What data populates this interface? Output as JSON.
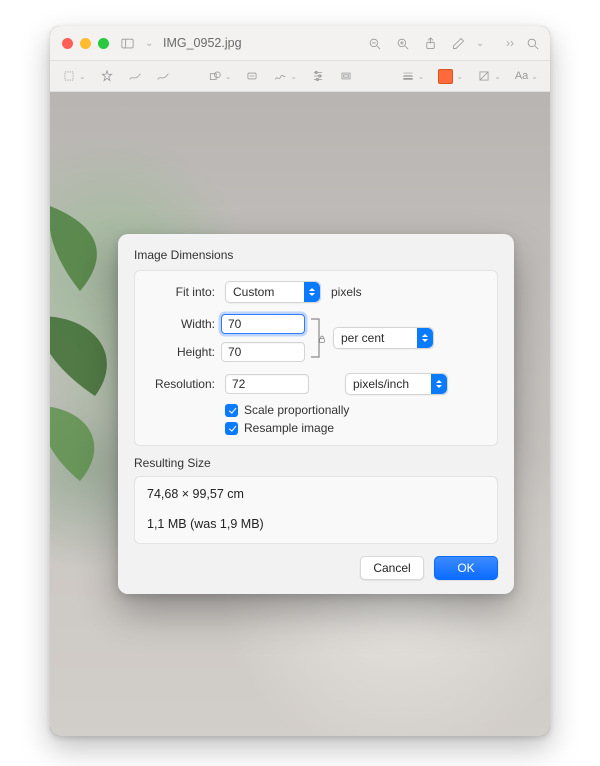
{
  "window": {
    "title": "IMG_0952.jpg"
  },
  "dialog": {
    "section_title": "Image Dimensions",
    "fit_into_label": "Fit into:",
    "fit_into_value": "Custom",
    "fit_into_unit": "pixels",
    "width_label": "Width:",
    "width_value": "70",
    "height_label": "Height:",
    "height_value": "70",
    "wh_unit": "per cent",
    "resolution_label": "Resolution:",
    "resolution_value": "72",
    "resolution_unit": "pixels/inch",
    "scale_prop_label": "Scale proportionally",
    "resample_label": "Resample image",
    "scale_prop_checked": true,
    "resample_checked": true,
    "resulting_title": "Resulting Size",
    "resulting_dims": "74,68 × 99,57 cm",
    "resulting_size": "1,1 MB (was 1,9 MB)",
    "cancel": "Cancel",
    "ok": "OK"
  }
}
